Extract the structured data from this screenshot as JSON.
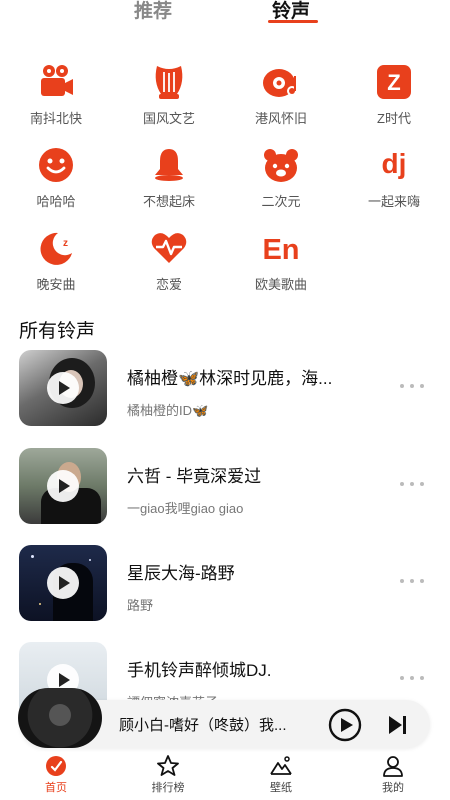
{
  "colors": {
    "accent": "#e8401c",
    "text": "#111111",
    "muted": "#777777"
  },
  "tabs": [
    {
      "label": "推荐",
      "active": false
    },
    {
      "label": "铃声",
      "active": true
    }
  ],
  "categories": [
    {
      "label": "南抖北快",
      "icon": "video-camera-icon"
    },
    {
      "label": "国风文艺",
      "icon": "lyre-icon"
    },
    {
      "label": "港风怀旧",
      "icon": "vinyl-music-icon"
    },
    {
      "label": "Z时代",
      "icon": "z-badge-icon"
    },
    {
      "label": "哈哈哈",
      "icon": "smile-face-icon"
    },
    {
      "label": "不想起床",
      "icon": "bell-icon"
    },
    {
      "label": "二次元",
      "icon": "bear-face-icon"
    },
    {
      "label": "一起来嗨",
      "icon": "dj-icon"
    },
    {
      "label": "晚安曲",
      "icon": "moon-sleep-icon"
    },
    {
      "label": "恋爱",
      "icon": "heartbeat-icon"
    },
    {
      "label": "欧美歌曲",
      "icon": "en-text-icon",
      "icon_text": "En"
    }
  ],
  "section_title": "所有铃声",
  "songs": [
    {
      "title": "橘柚橙🦋林深时见鹿，海...",
      "subtitle": "橘柚橙的ID🦋"
    },
    {
      "title": "六哲 - 毕竟深爱过",
      "subtitle": "一giao我哩giao giao"
    },
    {
      "title": "星辰大海-路野",
      "subtitle": "路野"
    },
    {
      "title": "手机铃声醉倾城DJ.",
      "subtitle": "譚佣寧浓喜花子"
    }
  ],
  "player": {
    "title": "顾小白-嗜好（咚鼓）我..."
  },
  "nav": [
    {
      "label": "首页",
      "icon": "home-music-icon",
      "active": true
    },
    {
      "label": "排行榜",
      "icon": "star-icon",
      "active": false
    },
    {
      "label": "壁纸",
      "icon": "mountain-icon",
      "active": false
    },
    {
      "label": "我的",
      "icon": "user-icon",
      "active": false
    }
  ]
}
